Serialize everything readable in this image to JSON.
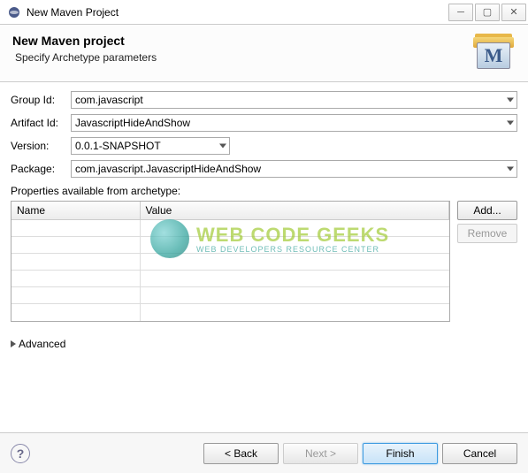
{
  "window": {
    "title": "New Maven Project"
  },
  "header": {
    "title": "New Maven project",
    "subtitle": "Specify Archetype parameters"
  },
  "form": {
    "group_id": {
      "label": "Group Id:",
      "value": "com.javascript"
    },
    "artifact_id": {
      "label": "Artifact Id:",
      "value": "JavascriptHideAndShow"
    },
    "version": {
      "label": "Version:",
      "value": "0.0.1-SNAPSHOT"
    },
    "package": {
      "label": "Package:",
      "value": "com.javascript.JavascriptHideAndShow"
    }
  },
  "properties": {
    "section_label": "Properties available from archetype:",
    "columns": {
      "name": "Name",
      "value": "Value"
    },
    "buttons": {
      "add": "Add...",
      "remove": "Remove"
    }
  },
  "advanced": {
    "label": "Advanced"
  },
  "footer": {
    "back": "< Back",
    "next": "Next >",
    "finish": "Finish",
    "cancel": "Cancel"
  },
  "watermark": {
    "line1": "WEB CODE GEEKS",
    "line2": "WEB DEVELOPERS RESOURCE CENTER"
  }
}
